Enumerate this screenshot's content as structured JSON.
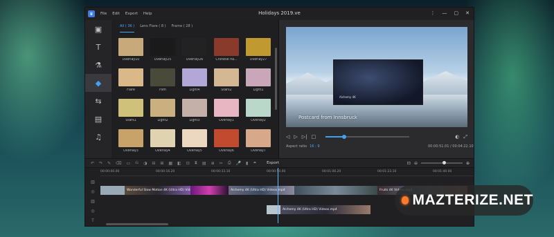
{
  "window": {
    "title": "Holidays 2019.ve",
    "menu": [
      "File",
      "Edit",
      "Export",
      "Help"
    ],
    "controls": [
      "⋮",
      "—",
      "▢",
      "✕"
    ]
  },
  "rail": {
    "items": [
      {
        "icon": "media-icon",
        "glyph": "▣"
      },
      {
        "icon": "text-icon",
        "glyph": "T"
      },
      {
        "icon": "filters-icon",
        "glyph": "⚗"
      },
      {
        "icon": "overlays-icon",
        "glyph": "◆",
        "active": true
      },
      {
        "icon": "transitions-icon",
        "glyph": "⇆"
      },
      {
        "icon": "elements-icon",
        "glyph": "▤"
      },
      {
        "icon": "music-icon",
        "glyph": "♫"
      }
    ]
  },
  "panel": {
    "tabs": [
      {
        "label": "All ( 36 )",
        "active": true
      },
      {
        "label": "Lens Flare ( 8 )"
      },
      {
        "label": "Frame ( 28 )"
      }
    ],
    "items": [
      {
        "label": "Overlay10",
        "color": "#c8a97a"
      },
      {
        "label": "Overlay25",
        "color": "#1a1a1a"
      },
      {
        "label": "Overlay26",
        "color": "#222222"
      },
      {
        "label": "Chinese ha...",
        "color": "#8a3a2a"
      },
      {
        "label": "Overlay27",
        "color": "#c09a30"
      },
      {
        "label": "Flare",
        "color": "#d9b88a"
      },
      {
        "label": "Film",
        "color": "#4a4a3a"
      },
      {
        "label": "Light4",
        "color": "#b2a7d6"
      },
      {
        "label": "Stars2",
        "color": "#d4b894"
      },
      {
        "label": "Light1",
        "color": "#c9a6b8"
      },
      {
        "label": "Stars1",
        "color": "#cfc07a"
      },
      {
        "label": "Light2",
        "color": "#c9b07e"
      },
      {
        "label": "Light3",
        "color": "#c4b0a8"
      },
      {
        "label": "Overlay1",
        "color": "#e8b6c2"
      },
      {
        "label": "Overlay2",
        "color": "#b9d8c9"
      },
      {
        "label": "Overlay3",
        "color": "#c7a36a"
      },
      {
        "label": "Overlay4",
        "color": "#e0d4b0"
      },
      {
        "label": "Overlay5",
        "color": "#ecd8c0"
      },
      {
        "label": "Overlay6",
        "color": "#c24a2e"
      },
      {
        "label": "Overlay7",
        "color": "#d8a88a"
      }
    ]
  },
  "preview": {
    "caption": "Postcard from Innsbruck",
    "inset_caption": "Alchemy 4K"
  },
  "player": {
    "buttons": [
      "◁",
      "▷",
      "▷|",
      "□"
    ],
    "right_buttons": [
      "◐",
      "⤢"
    ],
    "progress": 0.22,
    "aspect_label": "Aspect ratio",
    "aspect_value": "16 : 9",
    "time": "00:00:51.01 / 00:04:22.10"
  },
  "toolbar": {
    "tools": [
      "↶",
      "↷",
      "✎",
      "⌫",
      "▭",
      "⎌",
      "◑",
      "⊟",
      "⊞",
      "▦",
      "◧",
      "⊡",
      "⧗",
      "▤",
      "⊕",
      "✂",
      "⎙",
      "🎤",
      "▮",
      "⏶"
    ],
    "export_label": "Export",
    "zoom_out": "⊖",
    "zoom_in": "⊕",
    "zoom_fit": "⊡",
    "zoom_level": 0.55
  },
  "timeline": {
    "ticks": [
      "00:00:00.00",
      "00:00:16.20",
      "00:00:33.10",
      "00:00:50.00",
      "00:01:06.20",
      "00:01:23.10",
      "00:01:40.00",
      "00:01:56.20"
    ],
    "track_icons": [
      "▥",
      "◎",
      "▥",
      "◎",
      "T"
    ],
    "clip1_label": "Wonderful Slow Motion 4K (Ultra HD) Videos.mp4",
    "clip2_label": "Alchemy 4K (Ultra HD) Videos.mp4",
    "clip3_label": "Fruits 4K Videos.mp4",
    "clip4_label": "Alchemy 4K (Ultra HD) Videos.mp4"
  },
  "watermark": {
    "text": "MAZTERIZE.NET"
  }
}
